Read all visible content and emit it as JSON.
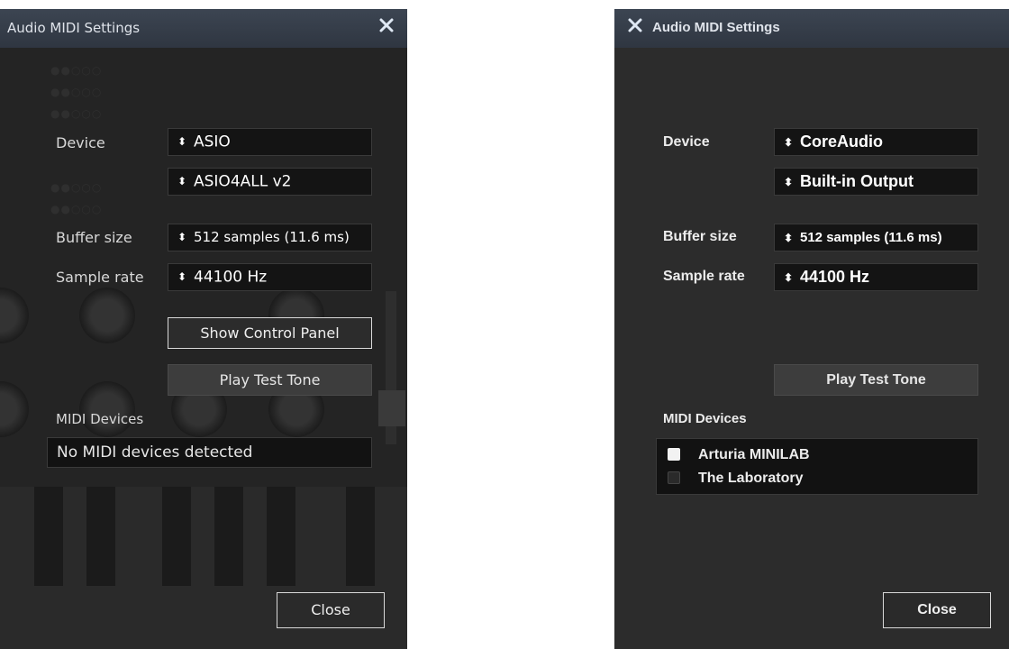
{
  "left": {
    "title": "Audio MIDI Settings",
    "labels": {
      "device": "Device",
      "buffer_size": "Buffer size",
      "sample_rate": "Sample rate",
      "midi_devices": "MIDI Devices"
    },
    "device_type": "ASIO",
    "device_output": "ASIO4ALL v2",
    "buffer_size": "512 samples (11.6 ms)",
    "sample_rate": "44100 Hz",
    "show_control_panel": "Show Control Panel",
    "play_test_tone": "Play Test Tone",
    "midi_status": "No MIDI devices detected",
    "close": "Close"
  },
  "right": {
    "title": "Audio MIDI Settings",
    "labels": {
      "device": "Device",
      "buffer_size": "Buffer size",
      "sample_rate": "Sample rate",
      "midi_devices": "MIDI Devices"
    },
    "device_type": "CoreAudio",
    "device_output": "Built-in Output",
    "buffer_size": "512 samples (11.6 ms)",
    "sample_rate": "44100 Hz",
    "play_test_tone": "Play Test Tone",
    "midi_devices": [
      {
        "name": "Arturia MINILAB",
        "enabled": true
      },
      {
        "name": "The Laboratory",
        "enabled": false
      }
    ],
    "close": "Close"
  },
  "icons": {
    "close": "close-x-icon",
    "select_arrows": "up-down-arrows-icon"
  },
  "colors": {
    "titlebar": "#3c4552",
    "window_bg_left": "#242424",
    "window_bg_right": "#2c2c2c",
    "field_bg": "#141414"
  }
}
